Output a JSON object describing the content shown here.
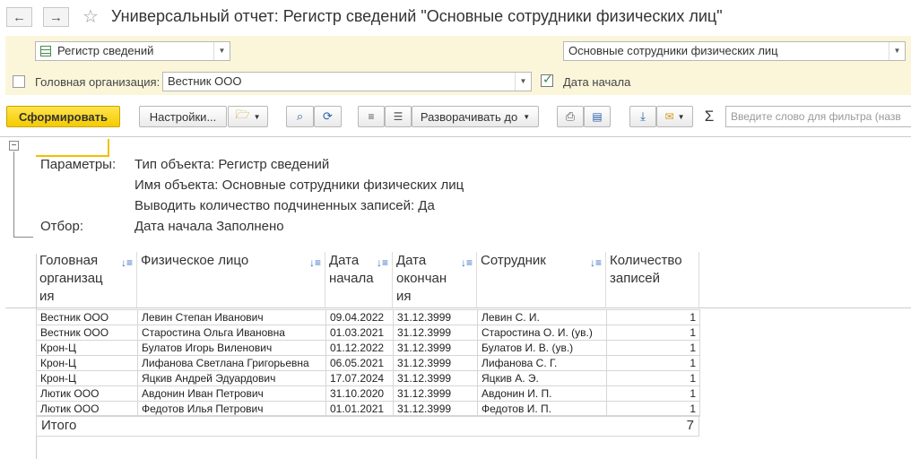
{
  "window": {
    "title": "Универсальный отчет: Регистр сведений \"Основные сотрудники физических лиц\"",
    "back_icon": "←",
    "forward_icon": "→",
    "star_icon": "☆"
  },
  "params": {
    "object_type": "Регистр сведений",
    "object_name": "Основные сотрудники физических лиц",
    "head_org_label": "Головная организация:",
    "head_org_value": "Вестник ООО",
    "head_org_checked": false,
    "start_date_label": "Дата начала",
    "start_date_checked": true
  },
  "toolbar": {
    "generate": "Сформировать",
    "settings": "Настройки...",
    "expand_to": "Разворачивать до",
    "sum_icon": "Σ",
    "filter_placeholder": "Введите слово для фильтра (назв"
  },
  "report": {
    "parameters_label": "Параметры:",
    "param_lines": [
      "Тип объекта: Регистр сведений",
      "Имя объекта: Основные сотрудники физических лиц",
      "Выводить количество подчиненных записей: Да"
    ],
    "filter_label": "Отбор:",
    "filter_value": "Дата начала Заполнено",
    "columns": [
      "Головная организац ия",
      "Физическое лицо",
      "Дата начала",
      "Дата окончан ия",
      "Сотрудник",
      "Количество записей"
    ],
    "rows": [
      [
        "Вестник ООО",
        "Левин Степан Иванович",
        "09.04.2022",
        "31.12.3999",
        "Левин С. И.",
        "1"
      ],
      [
        "Вестник ООО",
        "Старостина Ольга Ивановна",
        "01.03.2021",
        "31.12.3999",
        "Старостина О. И. (ув.)",
        "1"
      ],
      [
        "Крон-Ц",
        "Булатов Игорь Виленович",
        "01.12.2022",
        "31.12.3999",
        "Булатов И. В. (ув.)",
        "1"
      ],
      [
        "Крон-Ц",
        "Лифанова Светлана Григорьевна",
        "06.05.2021",
        "31.12.3999",
        "Лифанова С. Г.",
        "1"
      ],
      [
        "Крон-Ц",
        "Яцкив Андрей Эдуардович",
        "17.07.2024",
        "31.12.3999",
        "Яцкив А. Э.",
        "1"
      ],
      [
        "Лютик ООО",
        "Авдонин Иван Петрович",
        "31.10.2020",
        "31.12.3999",
        "Авдонин И. П.",
        "1"
      ],
      [
        "Лютик ООО",
        "Федотов Илья Петрович",
        "01.01.2021",
        "31.12.3999",
        "Федотов И. П.",
        "1"
      ]
    ],
    "total_label": "Итого",
    "total_value": "7"
  }
}
